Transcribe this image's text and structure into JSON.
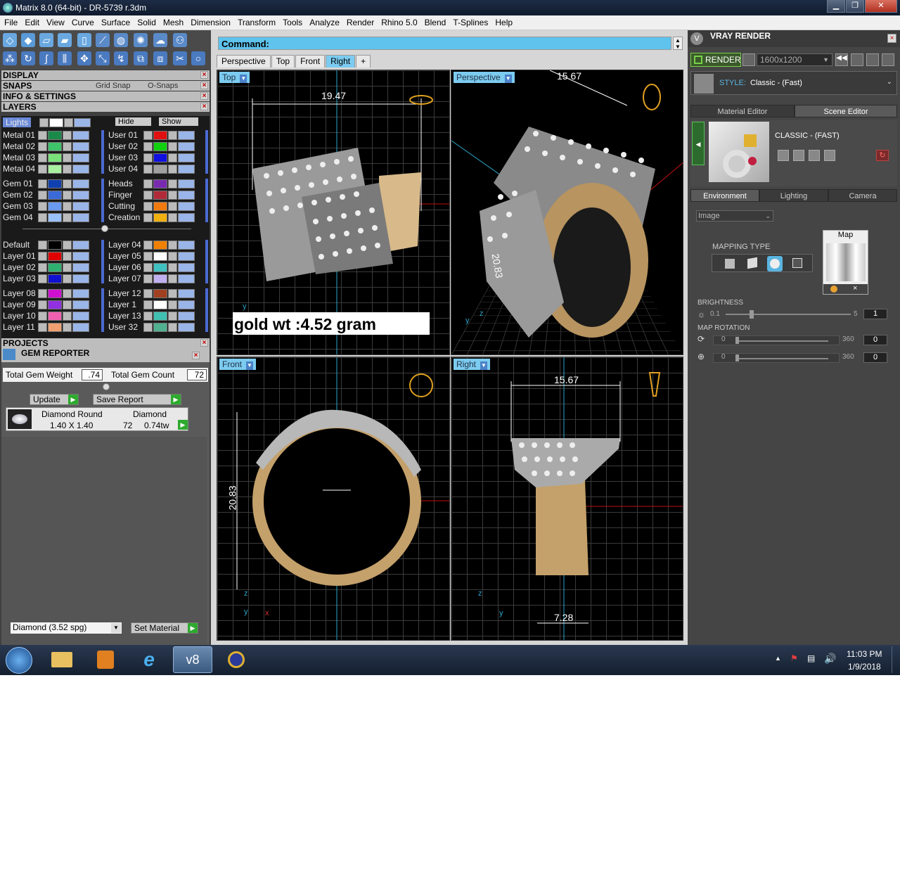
{
  "window": {
    "title": "Matrix 8.0 (64-bit) - DR-5739  r.3dm",
    "minimize": "▁",
    "maximize": "❐",
    "close": "✕"
  },
  "menu": [
    "File",
    "Edit",
    "View",
    "Curve",
    "Surface",
    "Solid",
    "Mesh",
    "Dimension",
    "Transform",
    "Tools",
    "Analyze",
    "Render",
    "Rhino 5.0",
    "Blend",
    "T-Splines",
    "Help"
  ],
  "left": {
    "sections": {
      "display": "DISPLAY",
      "snaps": "SNAPS",
      "grid_snap": "Grid Snap",
      "osnaps": "O-Snaps",
      "info": "INFO & SETTINGS",
      "layers": "LAYERS",
      "projects": "PROJECTS",
      "gem_reporter": "GEM REPORTER"
    },
    "layers_header": {
      "lights": "Lights",
      "hide": "Hide",
      "show": "Show"
    },
    "layers_left": [
      "Metal 01",
      "Metal 02",
      "Metal 03",
      "Metal 04",
      "Gem 01",
      "Gem 02",
      "Gem 03",
      "Gem 04",
      "Default",
      "Layer 01",
      "Layer 02",
      "Layer 03",
      "Layer 08",
      "Layer 09",
      "Layer 10",
      "Layer 11"
    ],
    "layers_right": [
      "User 01",
      "User 02",
      "User 03",
      "User 04",
      "Heads",
      "Finger",
      "Cutting",
      "Creation",
      "Layer 04",
      "Layer 05",
      "Layer 06",
      "Layer 07",
      "Layer 12",
      "Layer 1",
      "Layer 13",
      "User 32"
    ],
    "colors_left": [
      "#1a8a4a",
      "#3ec26a",
      "#7ae07a",
      "#a8f0a0",
      "#1040b0",
      "#3a6ad8",
      "#6a9af0",
      "#9ac0f8",
      "#000000",
      "#e00000",
      "#30b070",
      "#1010d0",
      "#d010d0",
      "#9030e0",
      "#f060b0",
      "#f0a070"
    ],
    "colors_right": [
      "#e01010",
      "#10d010",
      "#1010e0",
      "#a0a0a0",
      "#7a2ab0",
      "#b02a3a",
      "#f07a10",
      "#f0b010",
      "#f08000",
      "#ffffff",
      "#40c0c0",
      "#c0b0f0",
      "#a04020",
      "#ffffff",
      "#40c0b0",
      "#50b090"
    ],
    "gem": {
      "total_weight_label": "Total Gem Weight",
      "total_weight": ".74",
      "total_count_label": "Total Gem Count",
      "total_count": "72",
      "update": "Update",
      "save_report": "Save Report",
      "row": {
        "shape": "Diamond Round",
        "size": "1.40 X 1.40",
        "material": "Diamond",
        "count": "72",
        "weight": "0.74tw"
      },
      "material_select": "Diamond    (3.52 spg)",
      "set_material": "Set Material"
    }
  },
  "center": {
    "command_label": "Command:",
    "tabs": [
      "Perspective",
      "Top",
      "Front",
      "Right",
      "+"
    ],
    "active_tab": "Right",
    "viewports": {
      "top": "Top",
      "perspective": "Perspective",
      "front": "Front",
      "right": "Right"
    },
    "dims": {
      "top_width": "19.47",
      "persp_width": "15.67",
      "persp_height": "20.83",
      "front_height": "20.83",
      "right_width": "15.67",
      "right_bottom": "7.28"
    },
    "annotation": "gold wt :4.52 gram",
    "axes": {
      "x": "x",
      "y": "y",
      "z": "z"
    }
  },
  "right": {
    "title": "VRAY RENDER",
    "render_btn": "RENDER",
    "resolution": "1600x1200",
    "style_label": "STYLE:",
    "style_value": "Classic - (Fast)",
    "tabs": [
      "Material Editor",
      "Scene Editor"
    ],
    "active_tab": "Scene Editor",
    "scene_name": "CLASSIC - (FAST)",
    "env_tabs": [
      "Environment",
      "Lighting",
      "Camera"
    ],
    "env_select": "Image",
    "map_label": "Map",
    "mapping_type": "MAPPING TYPE",
    "brightness": {
      "label": "BRIGHTNESS",
      "min": "0.1",
      "max": "5",
      "value": "1"
    },
    "rotation": {
      "label": "MAP ROTATION",
      "min": "0",
      "max": "360",
      "value1": "0",
      "value2": "0"
    }
  },
  "taskbar": {
    "time": "11:03 PM",
    "date": "1/9/2018",
    "active_app": "v8"
  }
}
